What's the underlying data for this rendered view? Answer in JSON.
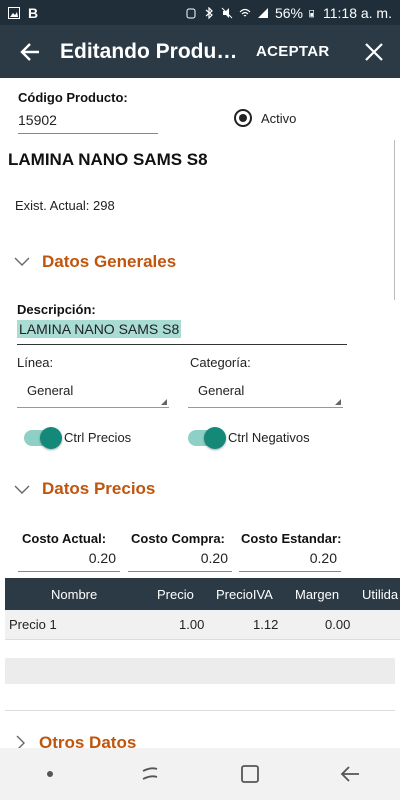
{
  "status_bar": {
    "carrier_badge": "B",
    "battery": "56%",
    "time": "11:18 a. m."
  },
  "app_bar": {
    "title": "Editando Producto",
    "accept_label": "ACEPTAR"
  },
  "product": {
    "code_label": "Código Producto:",
    "code_value": "15902",
    "active_label": "Activo",
    "active_selected": true,
    "name": "LAMINA NANO SAMS S8",
    "stock_text": "Exist. Actual: 298"
  },
  "general_section": {
    "title": "Datos Generales",
    "description_label": "Descripción:",
    "description_value": "LAMINA NANO SAMS S8",
    "line_label": "Línea:",
    "line_value": "General",
    "category_label": "Categoría:",
    "category_value": "General",
    "toggle_prices_label": "Ctrl Precios",
    "toggle_prices_on": true,
    "toggle_negatives_label": "Ctrl Negativos",
    "toggle_negatives_on": true
  },
  "prices_section": {
    "title": "Datos Precios",
    "cost_current_label": "Costo Actual:",
    "cost_current_value": "0.20",
    "cost_purchase_label": "Costo Compra:",
    "cost_purchase_value": "0.20",
    "cost_standard_label": "Costo Estandar:",
    "cost_standard_value": "0.20",
    "grid_columns": [
      "Nombre",
      "Precio",
      "PrecioIVA",
      "Margen",
      "Utilida"
    ],
    "grid_rows": [
      [
        "Precio 1",
        "1.00",
        "1.12",
        "0.00",
        ""
      ]
    ]
  },
  "other_section": {
    "title": "Otros Datos"
  },
  "colors": {
    "app_bar": "#2b3a45",
    "accent_orange": "#c0550e",
    "toggle_teal": "#14897a",
    "highlight": "#a9dcd3"
  }
}
